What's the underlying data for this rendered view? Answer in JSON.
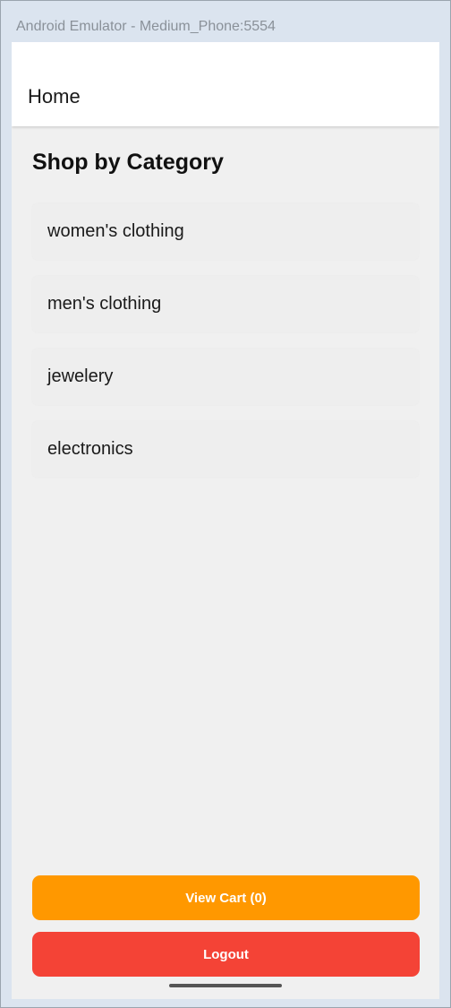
{
  "window": {
    "title": "Android Emulator - Medium_Phone:5554"
  },
  "appbar": {
    "title": "Home"
  },
  "main": {
    "section_title": "Shop by Category",
    "categories": [
      {
        "label": "women's clothing"
      },
      {
        "label": "men's clothing"
      },
      {
        "label": "jewelery"
      },
      {
        "label": "electronics"
      }
    ]
  },
  "actions": {
    "view_cart_label": "View Cart (0)",
    "logout_label": "Logout"
  },
  "colors": {
    "view_cart": "#ff9800",
    "logout": "#f44336",
    "background": "#f0f0f0",
    "appbar": "#ffffff"
  }
}
